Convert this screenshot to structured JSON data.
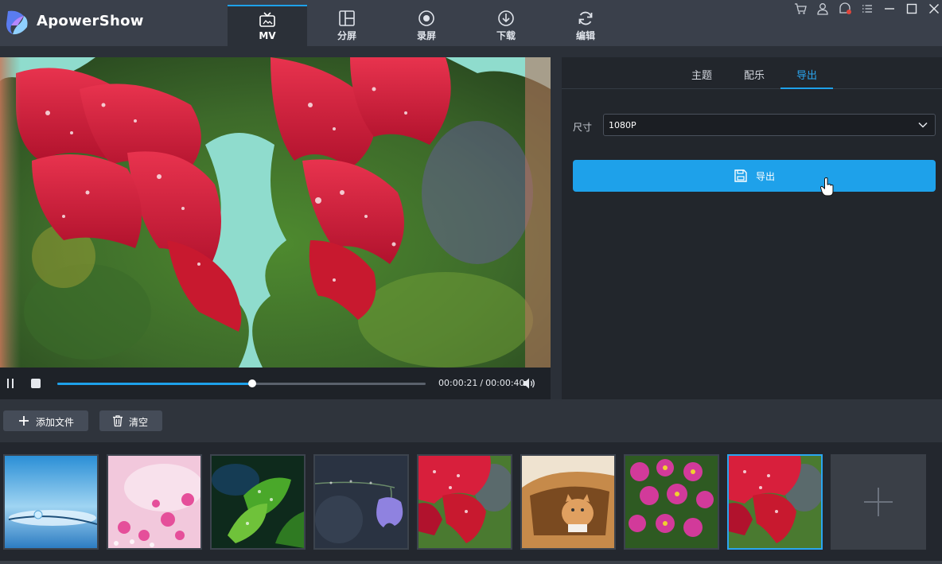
{
  "app": {
    "name": "ApowerShow"
  },
  "nav": {
    "tabs": [
      {
        "label": "MV",
        "icon": "tv-icon",
        "active": true
      },
      {
        "label": "分屏",
        "icon": "split-screen-icon",
        "active": false
      },
      {
        "label": "录屏",
        "icon": "record-icon",
        "active": false
      },
      {
        "label": "下载",
        "icon": "download-icon",
        "active": false
      },
      {
        "label": "编辑",
        "icon": "refresh-icon",
        "active": false
      }
    ]
  },
  "window_controls": [
    "cart-icon",
    "user-icon",
    "message-icon",
    "menu-icon",
    "minimize-icon",
    "maximize-icon",
    "close-icon"
  ],
  "player": {
    "current_time": "00:00:21",
    "separator": "/",
    "total_time": "00:00:40",
    "progress": 0.53
  },
  "panel": {
    "tabs": [
      {
        "label": "主题",
        "active": false
      },
      {
        "label": "配乐",
        "active": false
      },
      {
        "label": "导出",
        "active": true
      }
    ],
    "size_label": "尺寸",
    "size_value": "1080P",
    "export_label": "导出"
  },
  "files": {
    "add_label": "添加文件",
    "clear_label": "清空"
  },
  "thumbnails": [
    {
      "subject": "water-droplet",
      "selected": false
    },
    {
      "subject": "pink-flowers",
      "selected": false
    },
    {
      "subject": "green-leaves",
      "selected": false
    },
    {
      "subject": "purple-bellflower",
      "selected": false
    },
    {
      "subject": "red-gerbera",
      "selected": false
    },
    {
      "subject": "kitten-in-bag",
      "selected": false
    },
    {
      "subject": "pink-tulips",
      "selected": false
    },
    {
      "subject": "red-gerbera",
      "selected": true
    }
  ],
  "colors": {
    "accent": "#1ea1ea",
    "titlebar": "#3a404b",
    "panel": "#22262c",
    "background": "#2b3038"
  }
}
